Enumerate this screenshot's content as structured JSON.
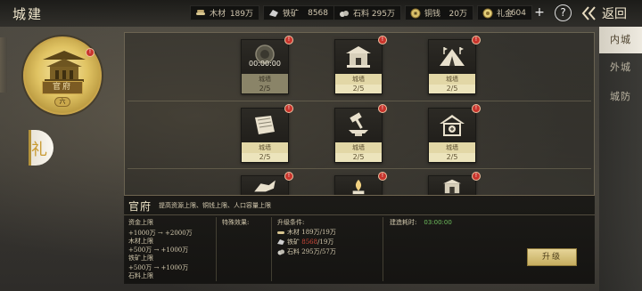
{
  "header": {
    "title": "城建",
    "back_label": "返回",
    "plus_label": "+",
    "help_label": "?"
  },
  "resources": [
    {
      "icon": "wood-icon",
      "label": "木材",
      "value": "189万"
    },
    {
      "icon": "iron-ore-icon",
      "label": "铁矿",
      "value": "8568"
    },
    {
      "icon": "stone-icon",
      "label": "石料",
      "value": "295万"
    },
    {
      "icon": "copper-coin-icon",
      "label": "铜钱",
      "value": "20万"
    },
    {
      "icon": "gift-gold-icon",
      "label": "礼金",
      "value": "604"
    }
  ],
  "emblem": {
    "label": "官府",
    "level": "六",
    "badge": "!"
  },
  "left_tab": {
    "glyph": "礼"
  },
  "right_nav": [
    {
      "label": "内城",
      "active": true
    },
    {
      "label": "外城",
      "active": false
    },
    {
      "label": "城防",
      "active": false
    }
  ],
  "buildings": [
    {
      "icon": "timer-medallion-icon",
      "name": "城墙",
      "level": "2/5",
      "timer": "00:00:00",
      "badge": "!",
      "dim": true
    },
    {
      "icon": "hall-building-icon",
      "name": "城墙",
      "level": "2/5",
      "badge": "!",
      "dim": false
    },
    {
      "icon": "tent-camp-icon",
      "name": "城墙",
      "level": "2/5",
      "badge": "!",
      "dim": false
    },
    {
      "icon": "book-icon",
      "name": "城墙",
      "level": "2/5",
      "badge": "!",
      "dim": false
    },
    {
      "icon": "anvil-hammer-icon",
      "name": "城墙",
      "level": "2/5",
      "badge": "!",
      "dim": false
    },
    {
      "icon": "clinic-house-icon",
      "name": "城墙",
      "level": "2/5",
      "badge": "!",
      "dim": false
    },
    {
      "icon": "war-beast-icon",
      "badge": "!"
    },
    {
      "icon": "furnace-flame-icon",
      "badge": "!"
    },
    {
      "icon": "gate-tower-icon",
      "badge": "!"
    }
  ],
  "detail": {
    "name": "官府",
    "description": "提高资源上限、铜钱上限、人口容量上限",
    "resource_caps": {
      "header": "资金上限",
      "lines": [
        "+1000万 → +2000万",
        "木材上限",
        "+500万 → +1000万",
        "铁矿上限",
        "+500万 → +1000万",
        "石料上限"
      ]
    },
    "special_effect": {
      "header": "特殊效果:"
    },
    "requirements": {
      "header": "升级条件:",
      "items": [
        {
          "icon": "wood-icon",
          "label": "木材",
          "have": "189万",
          "need": "/19万",
          "short": false
        },
        {
          "icon": "iron-ore-icon",
          "label": "铁矿",
          "have": "8568",
          "need": "/19万",
          "short": true
        },
        {
          "icon": "stone-icon",
          "label": "石料",
          "have": "295万",
          "need": "/57万",
          "short": false
        }
      ]
    },
    "build_time": {
      "label": "建造耗时:",
      "value": "03:00:00"
    },
    "upgrade_label": "升级"
  },
  "colors": {
    "accent_gold": "#c9a54a",
    "card_label_bg": "#e2d7a6",
    "shortage_red": "#d04a3a",
    "time_green": "#6fbf5e",
    "badge_red": "#c8342c"
  }
}
